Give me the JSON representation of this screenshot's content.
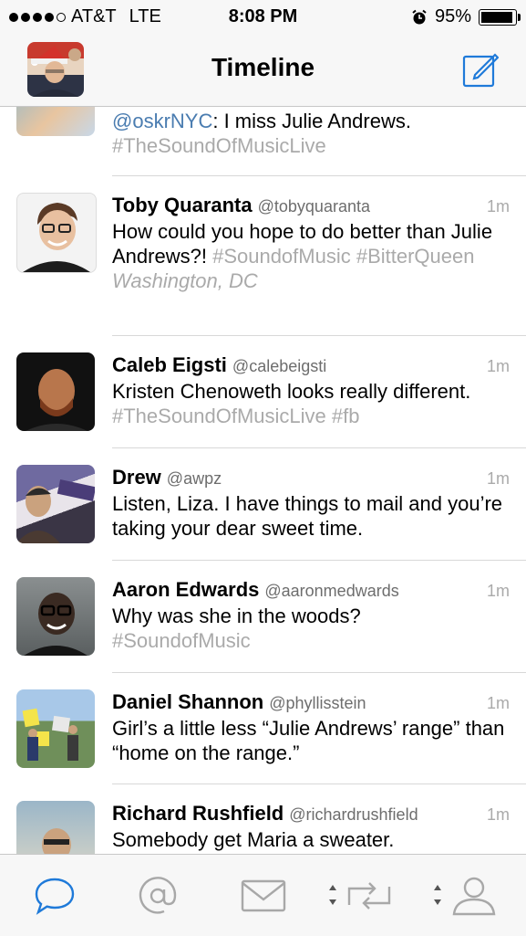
{
  "status": {
    "carrier": "AT&T",
    "network": "LTE",
    "time": "8:08 PM",
    "battery": "95%",
    "battery_level": 0.95
  },
  "nav": {
    "title": "Timeline"
  },
  "tweets": [
    {
      "text_mention": "@oskrNYC",
      "text": ": I miss Julie Andrews.",
      "tags": "#TheSoundOfMusicLive"
    },
    {
      "name": "Toby Quaranta",
      "handle": "@tobyquaranta",
      "time": "1m",
      "text": "How could you hope to do better than Julie Andrews?!",
      "tags": "#SoundofMusic #BitterQueen",
      "place": "Washington, DC"
    },
    {
      "name": "Caleb Eigsti",
      "handle": "@calebeigsti",
      "time": "1m",
      "text": "Kristen Chenoweth looks really different.",
      "tags": "#TheSoundOfMusicLive #fb"
    },
    {
      "name": "Drew",
      "handle": "@awpz",
      "time": "1m",
      "text": "Listen, Liza. I have things to mail and you’re taking your dear sweet time."
    },
    {
      "name": "Aaron Edwards",
      "handle": "@aaronmedwards",
      "time": "1m",
      "text": "Why was she in the woods?",
      "tags": "#SoundofMusic"
    },
    {
      "name": "Daniel Shannon",
      "handle": "@phyllisstein",
      "time": "1m",
      "text": "Girl’s a little less “Julie Andrews’ range” than “home on the range.”"
    },
    {
      "name": "Richard Rushfield",
      "handle": "@richardrushfield",
      "time": "1m",
      "text": "Somebody get Maria a sweater."
    }
  ],
  "tabs": [
    "timeline-icon",
    "mentions-icon",
    "messages-icon",
    "retweets-icon",
    "profile-icon"
  ],
  "colors": {
    "accent": "#1f7ad9",
    "tab_inactive": "#a8a8a8",
    "hashtag": "#aaaaaa",
    "mention": "#4a7cb0"
  }
}
